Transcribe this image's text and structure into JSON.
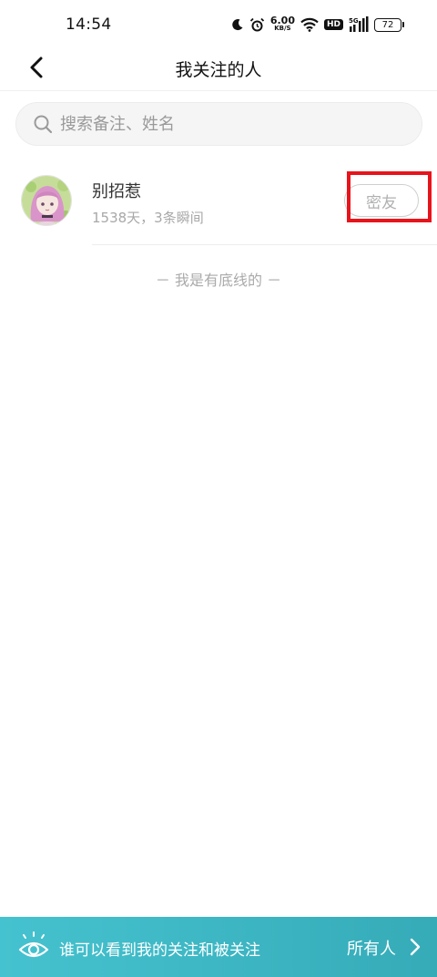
{
  "status_bar": {
    "time": "14:54",
    "net_speed_value": "6.00",
    "net_speed_unit": "KB/S",
    "hd_label": "HD",
    "signal_label": "5G",
    "battery_level": "72",
    "icons": [
      "moon-icon",
      "alarm-icon",
      "wifi-icon",
      "signal-icon",
      "battery-icon"
    ]
  },
  "nav": {
    "title": "我关注的人"
  },
  "search": {
    "placeholder": "搜索备注、姓名",
    "value": ""
  },
  "following": [
    {
      "name": "别招惹",
      "subtitle": "1538天，3条瞬间",
      "relation_button": "密友"
    }
  ],
  "end_message": "－ 我是有底线的 －",
  "bottom_bar": {
    "label": "谁可以看到我的关注和被关注",
    "value": "所有人"
  },
  "colors": {
    "bottom_bar_gradient_start": "#45c2cf",
    "bottom_bar_gradient_end": "#36abb8",
    "highlight": "#e8141b"
  }
}
